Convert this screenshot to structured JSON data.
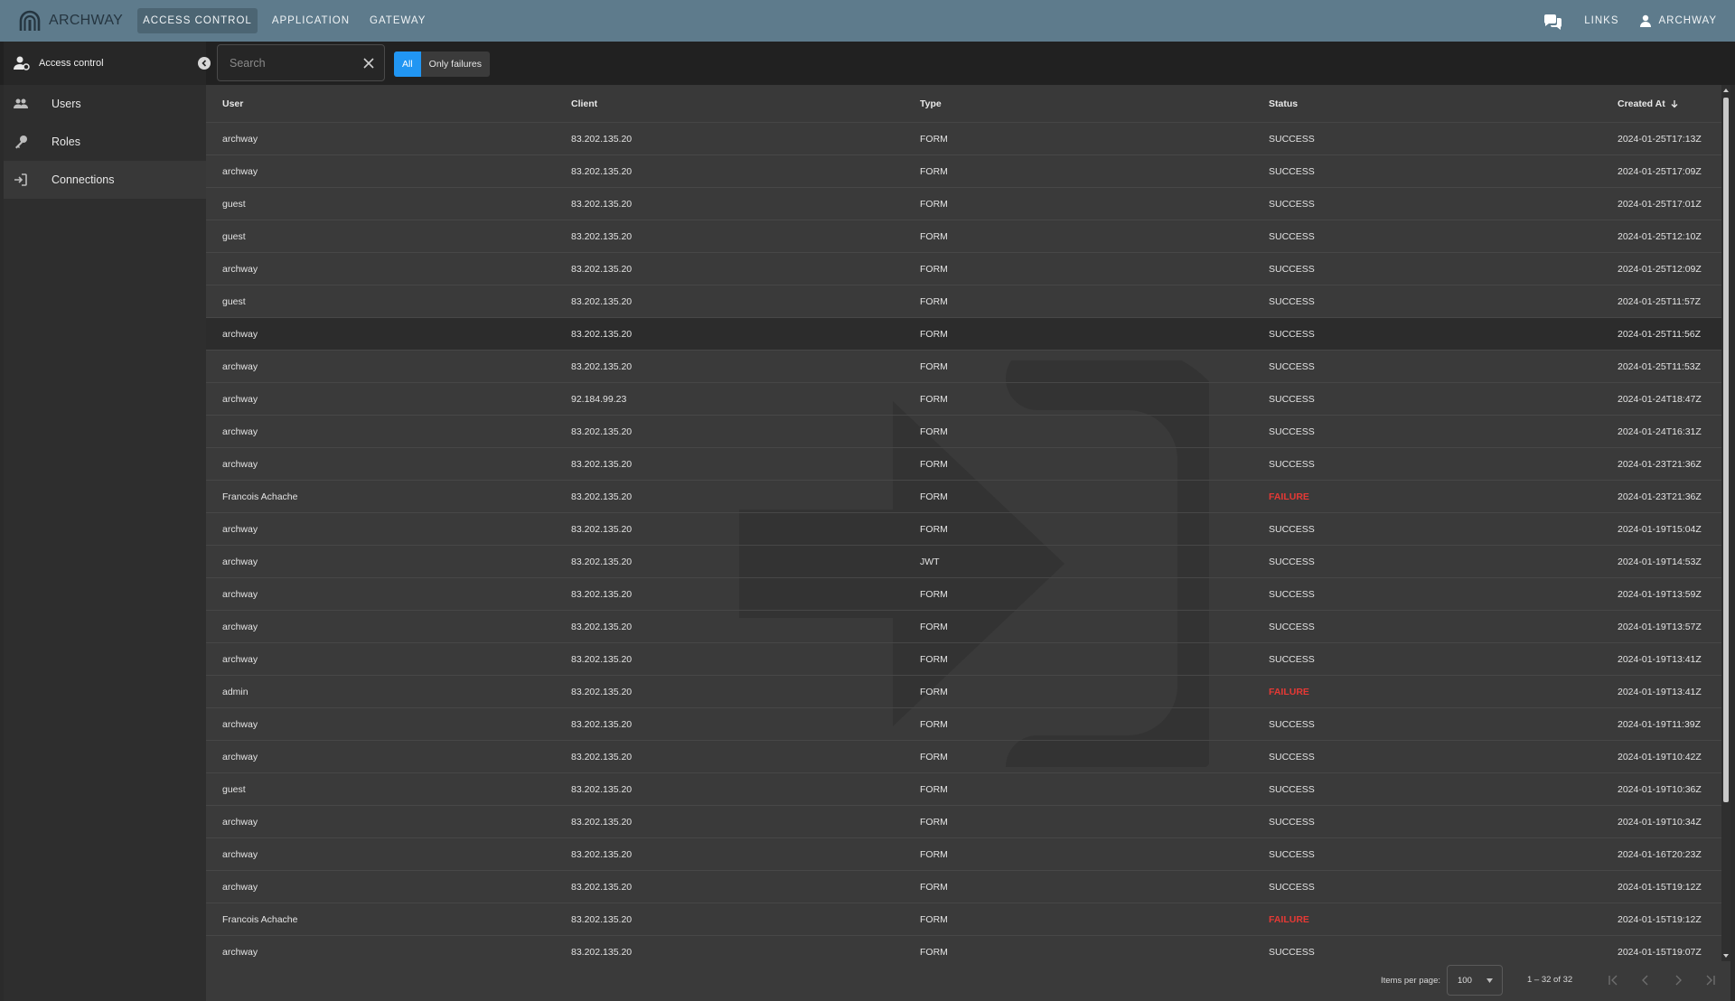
{
  "topbar": {
    "brand": "ARCHWAY",
    "nav": [
      {
        "label": "ACCESS CONTROL",
        "active": true
      },
      {
        "label": "APPLICATION",
        "active": false
      },
      {
        "label": "GATEWAY",
        "active": false
      }
    ],
    "links_label": "LINKS",
    "user_label": "ARCHWAY"
  },
  "sidenav": {
    "header": "Access control",
    "items": [
      {
        "label": "Users",
        "icon": "users-icon"
      },
      {
        "label": "Roles",
        "icon": "key-icon"
      },
      {
        "label": "Connections",
        "icon": "login-icon",
        "active": true
      }
    ]
  },
  "filter": {
    "search_placeholder": "Search",
    "toggle_all": "All",
    "toggle_failures": "Only failures"
  },
  "table": {
    "columns": {
      "user": "User",
      "client": "Client",
      "type": "Type",
      "status": "Status",
      "created": "Created At"
    },
    "rows": [
      {
        "user": "archway",
        "client": "83.202.135.20",
        "type": "FORM",
        "status": "SUCCESS",
        "created": "2024-01-25T17:13Z"
      },
      {
        "user": "archway",
        "client": "83.202.135.20",
        "type": "FORM",
        "status": "SUCCESS",
        "created": "2024-01-25T17:09Z"
      },
      {
        "user": "guest",
        "client": "83.202.135.20",
        "type": "FORM",
        "status": "SUCCESS",
        "created": "2024-01-25T17:01Z"
      },
      {
        "user": "guest",
        "client": "83.202.135.20",
        "type": "FORM",
        "status": "SUCCESS",
        "created": "2024-01-25T12:10Z"
      },
      {
        "user": "archway",
        "client": "83.202.135.20",
        "type": "FORM",
        "status": "SUCCESS",
        "created": "2024-01-25T12:09Z"
      },
      {
        "user": "guest",
        "client": "83.202.135.20",
        "type": "FORM",
        "status": "SUCCESS",
        "created": "2024-01-25T11:57Z"
      },
      {
        "user": "archway",
        "client": "83.202.135.20",
        "type": "FORM",
        "status": "SUCCESS",
        "created": "2024-01-25T11:56Z",
        "highlight": true
      },
      {
        "user": "archway",
        "client": "83.202.135.20",
        "type": "FORM",
        "status": "SUCCESS",
        "created": "2024-01-25T11:53Z"
      },
      {
        "user": "archway",
        "client": "92.184.99.23",
        "type": "FORM",
        "status": "SUCCESS",
        "created": "2024-01-24T18:47Z"
      },
      {
        "user": "archway",
        "client": "83.202.135.20",
        "type": "FORM",
        "status": "SUCCESS",
        "created": "2024-01-24T16:31Z"
      },
      {
        "user": "archway",
        "client": "83.202.135.20",
        "type": "FORM",
        "status": "SUCCESS",
        "created": "2024-01-23T21:36Z"
      },
      {
        "user": "Francois Achache",
        "client": "83.202.135.20",
        "type": "FORM",
        "status": "FAILURE",
        "created": "2024-01-23T21:36Z"
      },
      {
        "user": "archway",
        "client": "83.202.135.20",
        "type": "FORM",
        "status": "SUCCESS",
        "created": "2024-01-19T15:04Z"
      },
      {
        "user": "archway",
        "client": "83.202.135.20",
        "type": "JWT",
        "status": "SUCCESS",
        "created": "2024-01-19T14:53Z"
      },
      {
        "user": "archway",
        "client": "83.202.135.20",
        "type": "FORM",
        "status": "SUCCESS",
        "created": "2024-01-19T13:59Z"
      },
      {
        "user": "archway",
        "client": "83.202.135.20",
        "type": "FORM",
        "status": "SUCCESS",
        "created": "2024-01-19T13:57Z"
      },
      {
        "user": "archway",
        "client": "83.202.135.20",
        "type": "FORM",
        "status": "SUCCESS",
        "created": "2024-01-19T13:41Z"
      },
      {
        "user": "admin",
        "client": "83.202.135.20",
        "type": "FORM",
        "status": "FAILURE",
        "created": "2024-01-19T13:41Z"
      },
      {
        "user": "archway",
        "client": "83.202.135.20",
        "type": "FORM",
        "status": "SUCCESS",
        "created": "2024-01-19T11:39Z"
      },
      {
        "user": "archway",
        "client": "83.202.135.20",
        "type": "FORM",
        "status": "SUCCESS",
        "created": "2024-01-19T10:42Z"
      },
      {
        "user": "guest",
        "client": "83.202.135.20",
        "type": "FORM",
        "status": "SUCCESS",
        "created": "2024-01-19T10:36Z"
      },
      {
        "user": "archway",
        "client": "83.202.135.20",
        "type": "FORM",
        "status": "SUCCESS",
        "created": "2024-01-19T10:34Z"
      },
      {
        "user": "archway",
        "client": "83.202.135.20",
        "type": "FORM",
        "status": "SUCCESS",
        "created": "2024-01-16T20:23Z"
      },
      {
        "user": "archway",
        "client": "83.202.135.20",
        "type": "FORM",
        "status": "SUCCESS",
        "created": "2024-01-15T19:12Z"
      },
      {
        "user": "Francois Achache",
        "client": "83.202.135.20",
        "type": "FORM",
        "status": "FAILURE",
        "created": "2024-01-15T19:12Z"
      },
      {
        "user": "archway",
        "client": "83.202.135.20",
        "type": "FORM",
        "status": "SUCCESS",
        "created": "2024-01-15T19:07Z"
      }
    ]
  },
  "paginator": {
    "items_per_page_label": "Items per page:",
    "page_size": "100",
    "range": "1 – 32 of 32"
  },
  "colors": {
    "topbar": "#5e7b8c",
    "accent": "#2196f3",
    "failure": "#e53935"
  }
}
